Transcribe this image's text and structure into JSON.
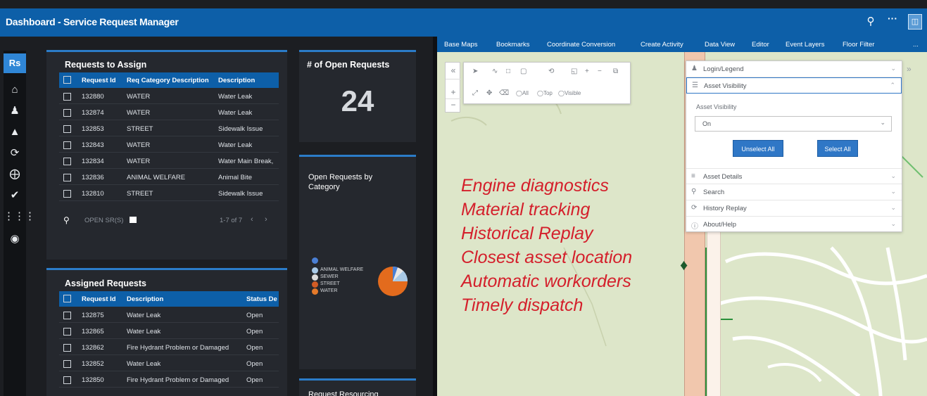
{
  "header": {
    "title": "Dashboard - Service Request Manager",
    "search_icon": "search-icon",
    "more_icon": "more-icon"
  },
  "rail": {
    "logo": "Rs",
    "icons": [
      "home-icon",
      "users-icon",
      "bell-icon",
      "history-icon",
      "add-icon",
      "check-icon",
      "apps-icon",
      "settings-icon"
    ]
  },
  "requests_to_assign": {
    "title": "Requests to Assign",
    "columns": [
      "Request Id",
      "Req Category Description",
      "Description"
    ],
    "rows": [
      [
        "132880",
        "WATER",
        "Water Leak"
      ],
      [
        "132874",
        "WATER",
        "Water Leak"
      ],
      [
        "132853",
        "STREET",
        "Sidewalk Issue"
      ],
      [
        "132843",
        "WATER",
        "Water Leak"
      ],
      [
        "132834",
        "WATER",
        "Water Main Break,"
      ],
      [
        "132836",
        "ANIMAL WELFARE",
        "Animal Bite"
      ],
      [
        "132810",
        "STREET",
        "Sidewalk Issue"
      ]
    ],
    "footer_label": "OPEN SR(S)",
    "pager": "1-7 of 7"
  },
  "open_requests": {
    "title": "# of Open Requests",
    "count": "24"
  },
  "by_category": {
    "title": "Open Requests by Category",
    "legend": [
      "ANIMAL WELFARE",
      "SEWER",
      "STREET",
      "WATER"
    ],
    "colors": [
      "#4a7fd4",
      "#a9c9e6",
      "#e8e8e8",
      "#e36b1d"
    ]
  },
  "assigned_requests": {
    "title": "Assigned Requests",
    "columns": [
      "Request Id",
      "Description",
      "Status De"
    ],
    "rows": [
      [
        "132875",
        "Water Leak",
        "Open"
      ],
      [
        "132865",
        "Water Leak",
        "Open"
      ],
      [
        "132862",
        "Fire Hydrant Problem or Damaged",
        "Open"
      ],
      [
        "132852",
        "Water Leak",
        "Open"
      ],
      [
        "132850",
        "Fire Hydrant Problem or Damaged",
        "Open"
      ]
    ]
  },
  "request_resourcing": {
    "title": "Request Resourcing"
  },
  "map_toolbar": {
    "tabs": [
      "Base Maps",
      "Bookmarks",
      "Coordinate Conversion",
      "Create Activity",
      "Data View",
      "Editor",
      "Event Layers",
      "Floor Filter"
    ],
    "more": "..."
  },
  "draw_tools": {
    "filters": [
      "All",
      "Top",
      "Visible"
    ]
  },
  "widget": {
    "login_legend": "Login/Legend",
    "asset_visibility_header": "Asset Visibility",
    "asset_visibility_label": "Asset Visibility",
    "asset_visibility_value": "On",
    "unselect_all": "Unselect All",
    "select_all": "Select All",
    "asset_details": "Asset Details",
    "search": "Search",
    "history_replay": "History Replay",
    "about_help": "About/Help"
  },
  "overlay_text": [
    "Engine diagnostics",
    "Material tracking",
    "Historical Replay",
    "Closest asset location",
    "Automatic workorders",
    "Timely dispatch"
  ],
  "colors": {
    "header_blue": "#0d5fa8",
    "overlay_red": "#d41f2b"
  }
}
